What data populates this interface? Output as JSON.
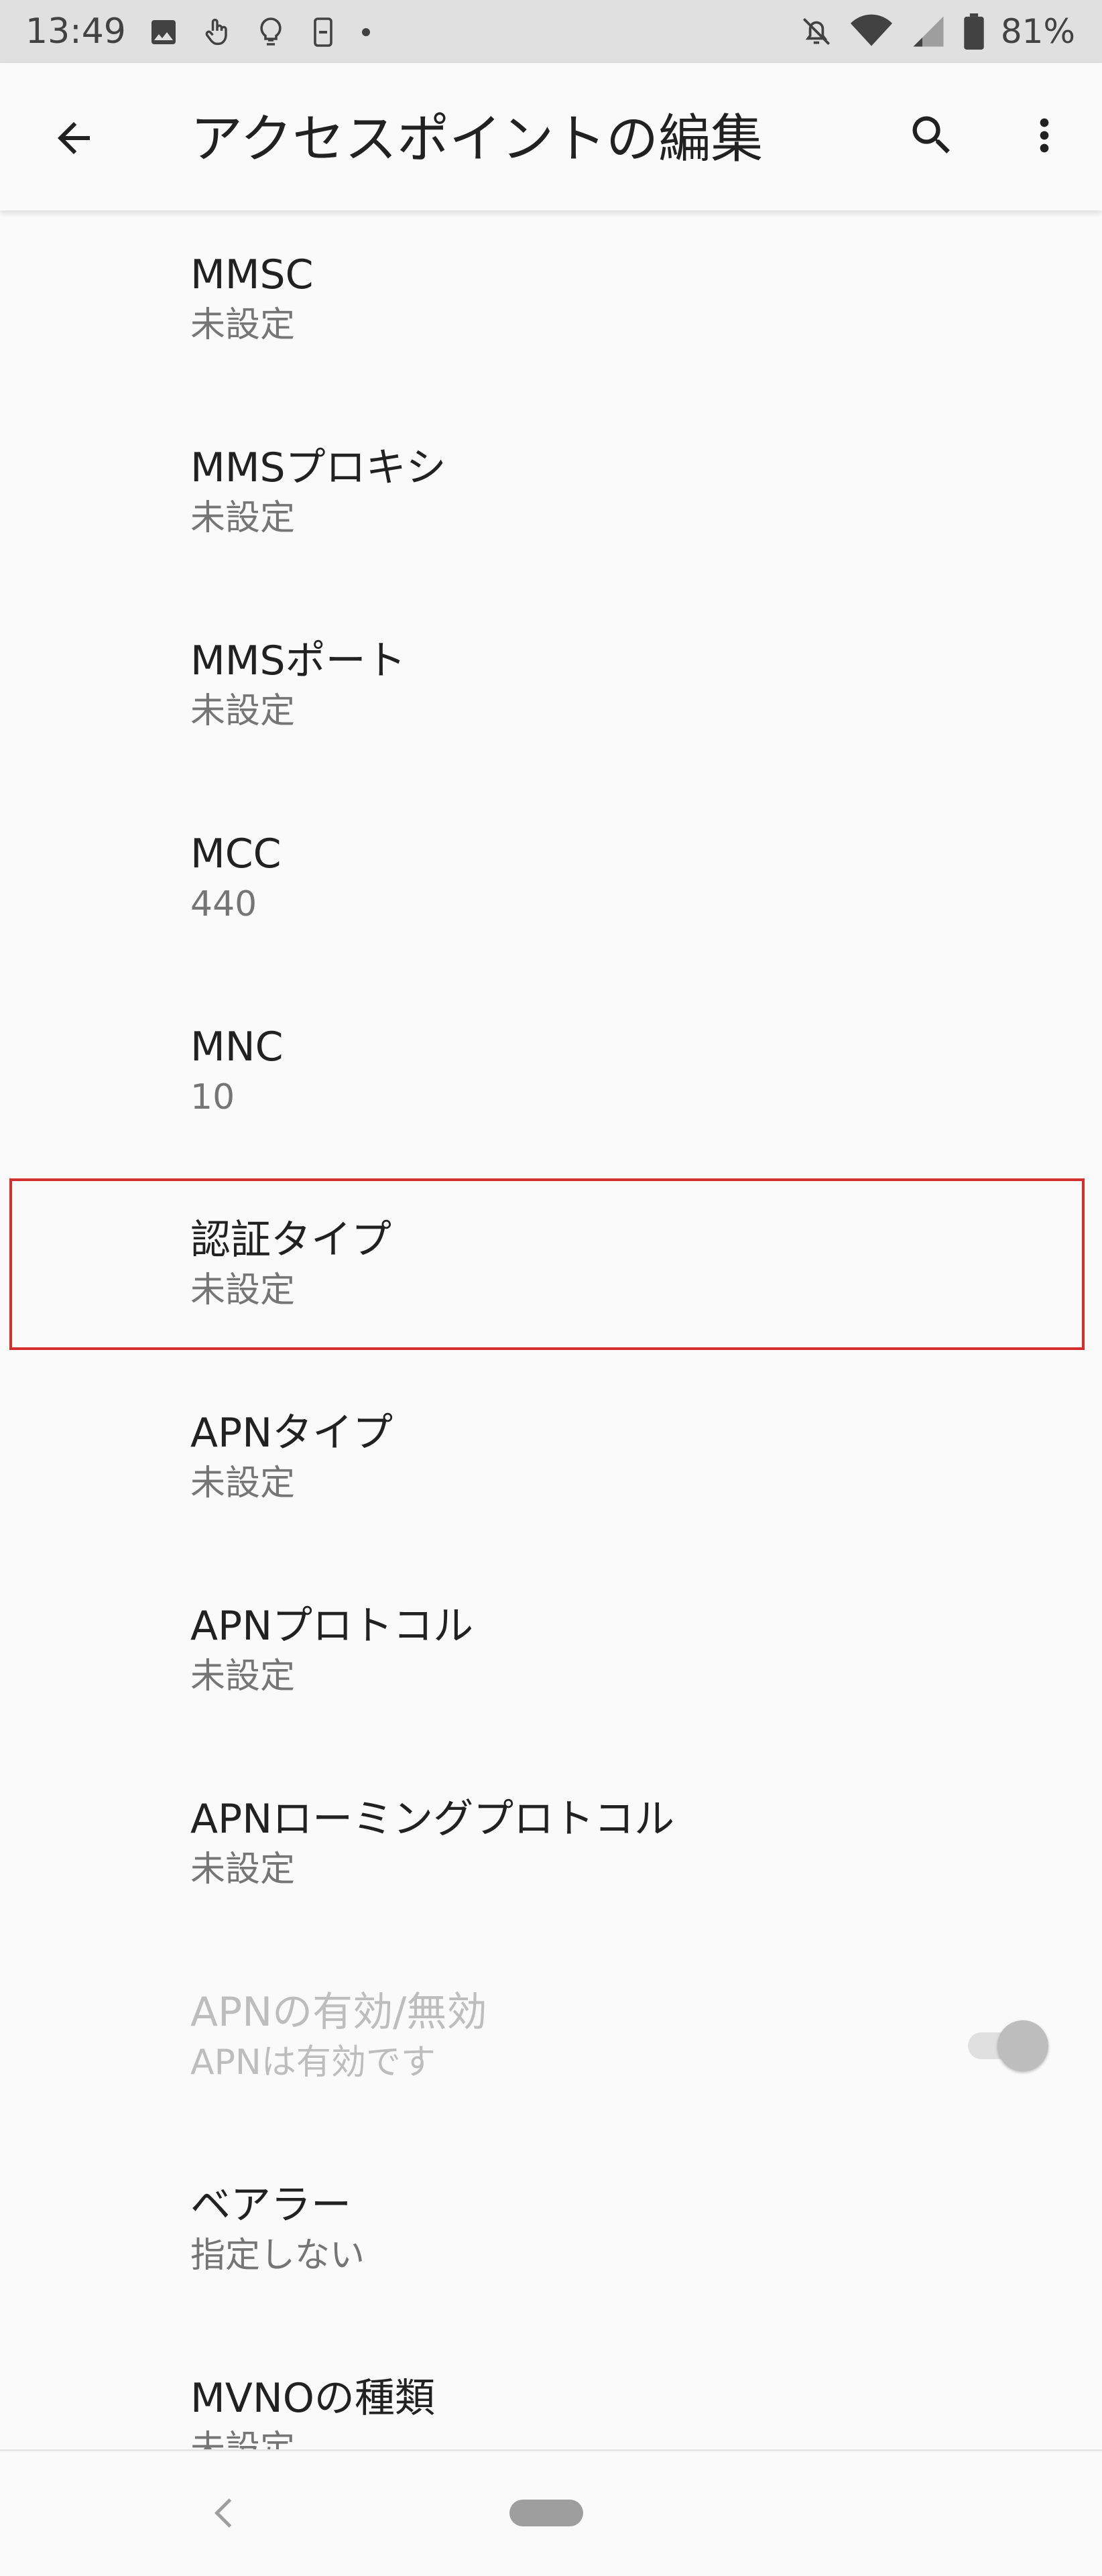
{
  "status_bar": {
    "time": "13:49",
    "battery": "81%",
    "icons_left": [
      "image-icon",
      "touch-icon",
      "bulb-icon",
      "device-icon",
      "dot-icon"
    ],
    "icons_right": [
      "notifications-off-icon",
      "wifi-icon",
      "signal-icon",
      "battery-icon"
    ]
  },
  "app_bar": {
    "title": "アクセスポイントの編集",
    "back_icon": "arrow-back-icon",
    "search_icon": "search-icon",
    "more_icon": "more-vert-icon"
  },
  "settings": [
    {
      "title": "MMSC",
      "value": "未設定"
    },
    {
      "title": "MMSプロキシ",
      "value": "未設定"
    },
    {
      "title": "MMSポート",
      "value": "未設定"
    },
    {
      "title": "MCC",
      "value": "440"
    },
    {
      "title": "MNC",
      "value": "10"
    },
    {
      "title": "認証タイプ",
      "value": "未設定"
    },
    {
      "title": "APNタイプ",
      "value": "未設定"
    },
    {
      "title": "APNプロトコル",
      "value": "未設定"
    },
    {
      "title": "APNローミングプロトコル",
      "value": "未設定"
    },
    {
      "title": "APNの有効/無効",
      "value": "APNは有効です",
      "toggle": true,
      "enabled": false
    },
    {
      "title": "ベアラー",
      "value": "指定しない"
    },
    {
      "title": "MVNOの種類",
      "value": "未設定"
    }
  ],
  "colors": {
    "status_bar_bg": "#e0e0e0",
    "background": "#fafafa",
    "highlight_border": "#d32f2f",
    "primary_text": "#212121",
    "secondary_text": "#757575"
  }
}
